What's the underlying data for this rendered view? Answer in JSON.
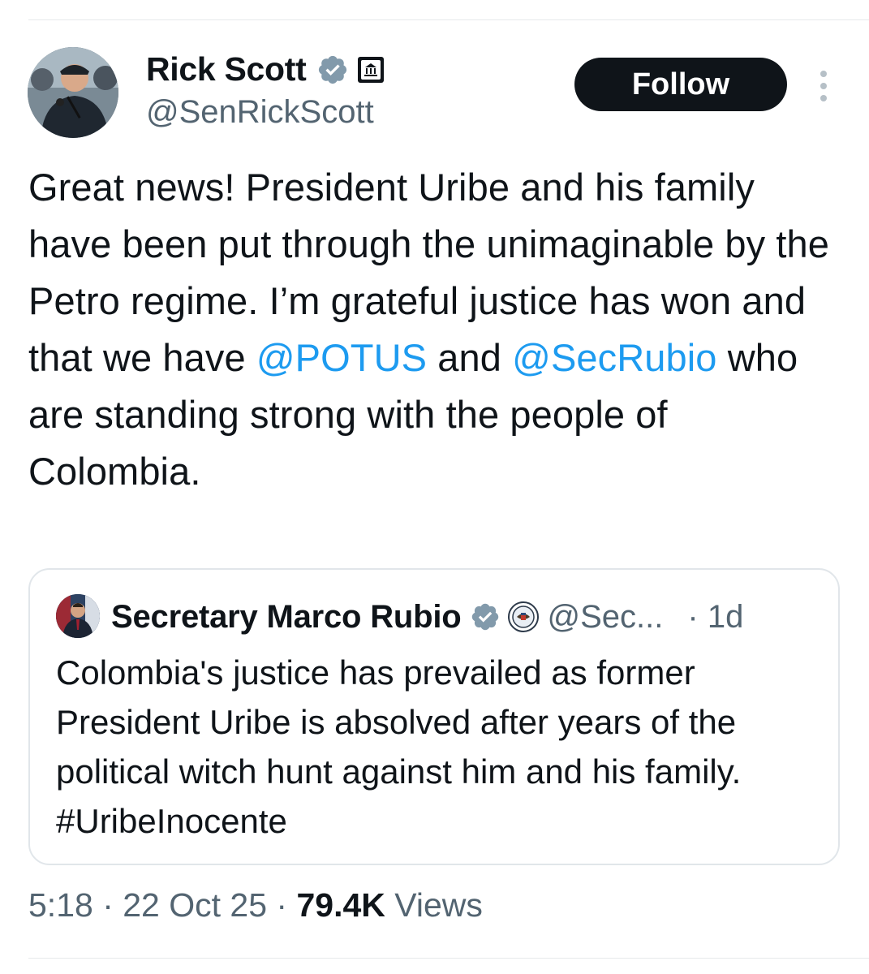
{
  "author": {
    "name": "Rick Scott",
    "handle": "@SenRickScott",
    "verified_icon": "verified-badge-icon",
    "affiliation_icon": "government-building-icon"
  },
  "follow_label": "Follow",
  "tweet": {
    "part1": "Great news! President Uribe and his family have been put through the unimaginable by the Petro regime. I’m grateful justice has won and that we have ",
    "mention1": "@POTUS",
    "part2": " and ",
    "mention2": "@SecRubio",
    "part3": " who are standing strong with the people of Colombia."
  },
  "quote": {
    "name": "Secretary Marco Rubio",
    "handle": "@Sec...",
    "time": "· 1d",
    "text": "Colombia's justice has prevailed as former President Uribe is absolved after years of the political witch hunt against him and his family. #UribeInocente"
  },
  "meta": {
    "time": "5:18",
    "dot1": " · ",
    "date": "22 Oct 25",
    "dot2": " · ",
    "views_count": "79.4K",
    "views_label": " Views"
  },
  "colors": {
    "link": "#1d9bf0",
    "text": "#0f1419",
    "secondary": "#536471",
    "verified": "#829aab"
  }
}
